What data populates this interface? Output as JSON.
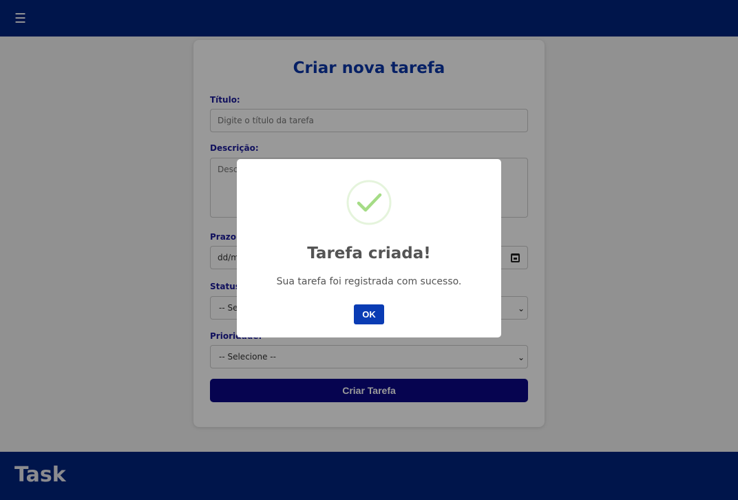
{
  "header": {
    "menu_icon": "hamburger-menu-icon",
    "menu_glyph": "☰"
  },
  "form": {
    "title": "Criar nova tarefa",
    "titulo_label": "Título:",
    "titulo_placeholder": "Digite o título da tarefa",
    "descricao_label": "Descrição:",
    "descricao_placeholder": "Descreva a tarefa",
    "prazo_label": "Prazo Final:",
    "prazo_placeholder": "dd/mm/aaaa",
    "status_label": "Status:",
    "status_value": "-- Selecione --",
    "prioridade_label": "Prioridade:",
    "prioridade_value": "-- Selecione --",
    "submit_label": "Criar Tarefa"
  },
  "modal": {
    "icon": "success-check-icon",
    "title": "Tarefa criada!",
    "text": "Sua tarefa foi registrada com sucesso.",
    "ok_label": "OK"
  },
  "footer": {
    "brand": "Task"
  },
  "colors": {
    "header_bg": "#00247d",
    "title_color": "#0a36a8",
    "label_color": "#1c1c9c",
    "submit_bg": "#0a0885",
    "ok_bg": "#0a3cb4",
    "success_green": "#a5dc86"
  }
}
